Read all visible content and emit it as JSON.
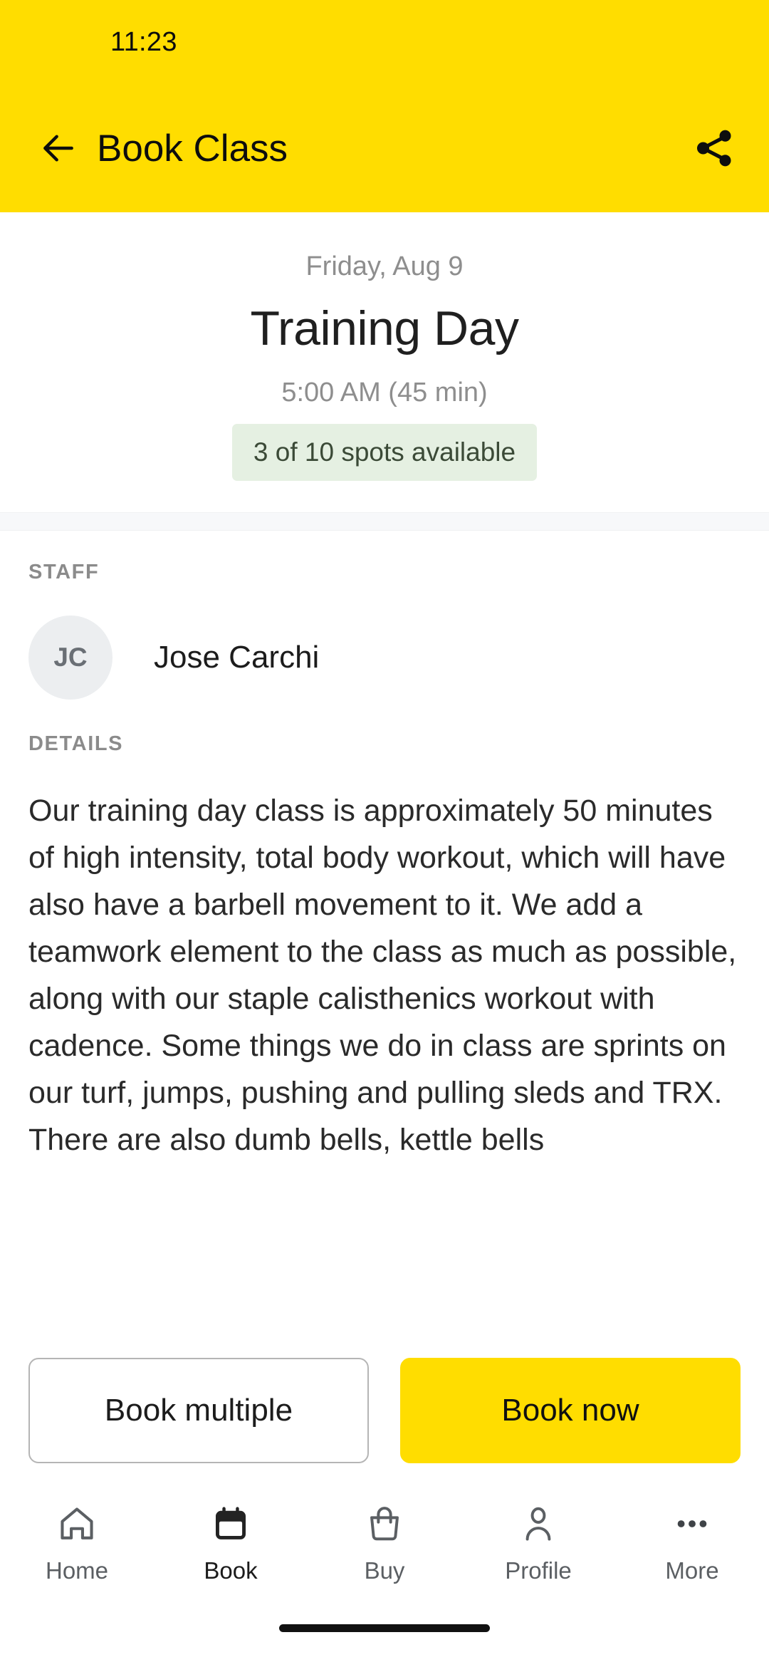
{
  "status_bar": {
    "time": "11:23"
  },
  "app_bar": {
    "title": "Book Class",
    "back_icon": "arrow-left-icon",
    "share_icon": "share-icon",
    "background_color": "#FFDD00"
  },
  "class": {
    "date": "Friday, Aug 9",
    "name": "Training Day",
    "time": "5:00 AM (45 min)",
    "spots": "3 of 10 spots available",
    "spots_bg_color": "#E5F0E2",
    "spots_text_color": "#3B4A37"
  },
  "staff": {
    "section_label": "STAFF",
    "members": [
      {
        "initials": "JC",
        "name": "Jose Carchi"
      }
    ]
  },
  "details": {
    "section_label": "DETAILS",
    "body": "Our training day class is approximately 50 minutes of high intensity, total body workout, which will have also have a barbell movement to it. We add a teamwork element to the class as much as possible, along with our staple calisthenics workout with cadence. Some things we do in class are sprints on our turf, jumps, pushing and pulling sleds and TRX. There are also dumb bells, kettle bells"
  },
  "actions": {
    "secondary_label": "Book multiple",
    "primary_label": "Book now",
    "primary_color": "#FFDD00"
  },
  "bottom_nav": {
    "items": [
      {
        "label": "Home",
        "icon": "home-icon",
        "active": false
      },
      {
        "label": "Book",
        "icon": "calendar-icon",
        "active": true
      },
      {
        "label": "Buy",
        "icon": "shopping-bag-icon",
        "active": false
      },
      {
        "label": "Profile",
        "icon": "person-icon",
        "active": false
      },
      {
        "label": "More",
        "icon": "more-dots-icon",
        "active": false
      }
    ]
  }
}
